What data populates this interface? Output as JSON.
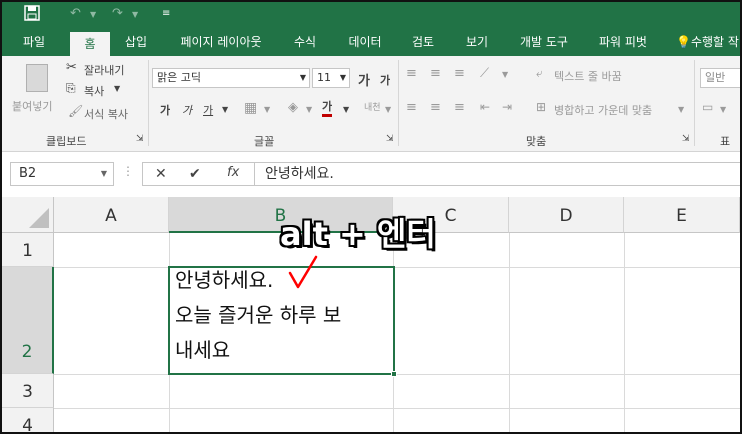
{
  "quick_access": {
    "undo_icon": "undo-icon",
    "redo_icon": "redo-icon",
    "customize_icon": "customize-icon"
  },
  "tabs": [
    "파일",
    "홈",
    "삽입",
    "페이지 레이아웃",
    "수식",
    "데이터",
    "검토",
    "보기",
    "개발 도구",
    "파워 피벗"
  ],
  "active_tab": "홈",
  "tell_me": "수행할 작",
  "ribbon": {
    "clipboard": {
      "paste": "붙여넣기",
      "cut": "잘라내기",
      "copy": "복사",
      "format_painter": "서식 복사",
      "label": "클립보드"
    },
    "font": {
      "name": "맑은 고딕",
      "size": "11",
      "grow": "가",
      "shrink": "가",
      "bold": "가",
      "italic": "가",
      "underline": "가",
      "font_color": "가",
      "phonetic": "내천",
      "label": "글꼴"
    },
    "alignment": {
      "wrap_text": "텍스트 줄 바꿈",
      "merge_center": "병합하고 가운데 맞춤",
      "label": "맞춤"
    },
    "number": {
      "format": "일반",
      "label": "표시"
    }
  },
  "formula_bar": {
    "name_box": "B2",
    "cancel": "✕",
    "enter": "✔",
    "fx": "fx",
    "content": "안녕하세요."
  },
  "grid": {
    "columns": [
      "A",
      "B",
      "C",
      "D",
      "E"
    ],
    "rows": [
      "1",
      "2",
      "3",
      "4"
    ],
    "selected_cell": "B2",
    "cell_b2_lines": [
      "안녕하세요.",
      "오늘 즐거운 하루 보",
      "내세요"
    ]
  },
  "annotation": {
    "text": "alt + 엔터",
    "color": "#ff0000"
  },
  "colors": {
    "accent": "#217346",
    "annotation_check": "#ff0000"
  }
}
